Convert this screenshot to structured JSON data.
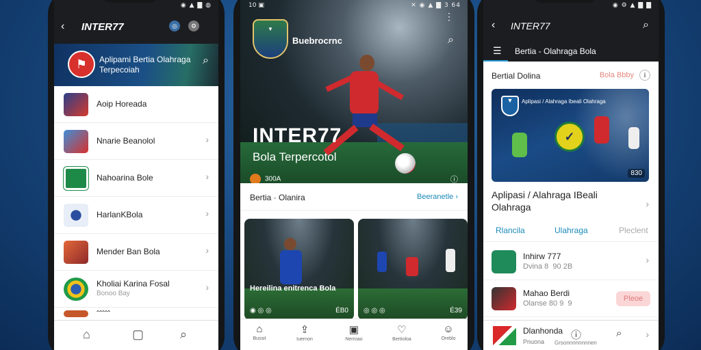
{
  "status": {
    "left_phone": "◉ ▲ ▇ ◍",
    "center_left": "10 ▣",
    "center_right": "✕ ◉ ▲ ▇ 3 64",
    "right_phone": "◉ ⚙ ▲ ▇ ▇"
  },
  "phone1": {
    "header_title": "INTER77",
    "banner_line1": "Aplipami Bertia Olahraga",
    "banner_line2": "Terpecoiah",
    "items": [
      {
        "label": "Aoip Horeada",
        "sub": ""
      },
      {
        "label": "Nnarie Beanolol",
        "sub": ""
      },
      {
        "label": "Nahoarina Bole",
        "sub": ""
      },
      {
        "label": "HarlanKBola",
        "sub": ""
      },
      {
        "label": "Mender Ban Bola",
        "sub": ""
      },
      {
        "label": "Kholiai Karina Fosal",
        "sub": "Bonoo Bay"
      },
      {
        "label": "ˆˆˆˆˆ",
        "sub": ""
      }
    ]
  },
  "phone2": {
    "brand": "Buebrocrnc",
    "hero_title": "INTER77",
    "hero_subtitle": "Bola Terpercotol",
    "hero_meta": "300A",
    "section_left": "Bertia · Olanira",
    "section_right": "Beeranetle",
    "card1": {
      "caption": "Hereilina enitrenca Bola",
      "foot": "◉ ◎ ◎",
      "num": "ÉB0"
    },
    "card2": {
      "foot": "◎ ◎ ◎",
      "num": "É39"
    },
    "nav": [
      {
        "label": "Bussit"
      },
      {
        "label": "Iuernon"
      },
      {
        "label": "Nerroao"
      },
      {
        "label": "Bertioloa"
      },
      {
        "label": "Oreblo"
      }
    ]
  },
  "phone3": {
    "header_title": "INTER77",
    "sub_title": "Bertia - Olahraga Bola",
    "section_left": "Bertial Dolina",
    "section_right": "Bola Bbby",
    "image_caption": "Aplipasi / Alahraga Ibeali Olahraga",
    "image_num": "830",
    "image_title_line1": "Aplipasi / Alahraga IBeali",
    "image_title_line2": "Olahraga",
    "tabs": [
      "Rlancila",
      "Ulahraga",
      "Pleclent"
    ],
    "rows": [
      {
        "title": "Inhirw 777",
        "sub": "Dvina 8  90 2B"
      },
      {
        "title": "Mahao Berdi",
        "sub": "Olanse 80 9  9",
        "button": "Pleoe"
      }
    ],
    "bottom_title": "Dlanhonda",
    "bottom_sub": "Pnuona",
    "bottom_sub2": "Grsonnnnnnnnen"
  },
  "colors": {
    "accent_blue": "#1b8ab8",
    "accent_red": "#d8302c",
    "dark_header": "#1c1d20"
  }
}
